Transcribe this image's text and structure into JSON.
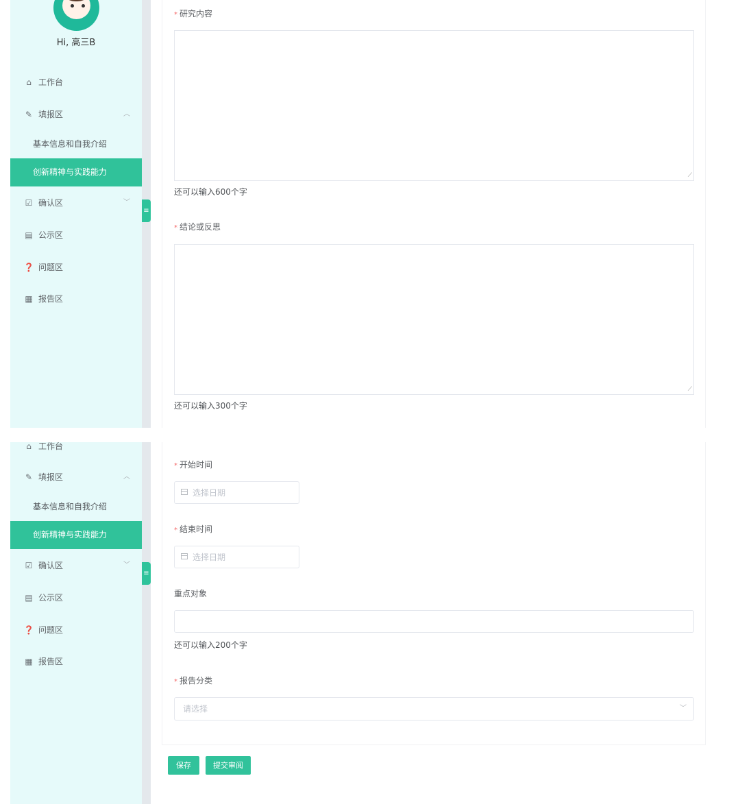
{
  "user": {
    "greeting": "Hi, 高三B"
  },
  "sidebar": {
    "items": [
      {
        "label": "工作台",
        "icon": "home-icon"
      },
      {
        "label": "填报区",
        "icon": "edit-icon",
        "expanded": true
      },
      {
        "label": "基本信息和自我介绍"
      },
      {
        "label": "创新精神与实践能力",
        "active": true
      },
      {
        "label": "确认区",
        "icon": "check-square-icon",
        "expanded": false
      },
      {
        "label": "公示区",
        "icon": "board-icon"
      },
      {
        "label": "问题区",
        "icon": "question-circle-icon"
      },
      {
        "label": "报告区",
        "icon": "file-icon"
      }
    ],
    "top_cut_label": "工作台"
  },
  "form": {
    "research_content": {
      "label": "研究内容",
      "required": true,
      "hint": "还可以输入600个字"
    },
    "conclusion": {
      "label": "结论或反思",
      "required": true,
      "hint": "还可以输入300个字"
    },
    "start_time": {
      "label": "开始时间",
      "required": true,
      "placeholder": "选择日期"
    },
    "end_time": {
      "label": "结束时间",
      "required": true,
      "placeholder": "选择日期"
    },
    "key_object": {
      "label": "重点对象",
      "hint": "还可以输入200个字"
    },
    "report_category": {
      "label": "报告分类",
      "required": true,
      "placeholder": "请选择"
    }
  },
  "actions": {
    "save": "保存",
    "submit": "提交审阅"
  },
  "colors": {
    "accent": "#30c29a",
    "sidebar_bg": "#e6fafa",
    "required": "#f56c6c"
  }
}
